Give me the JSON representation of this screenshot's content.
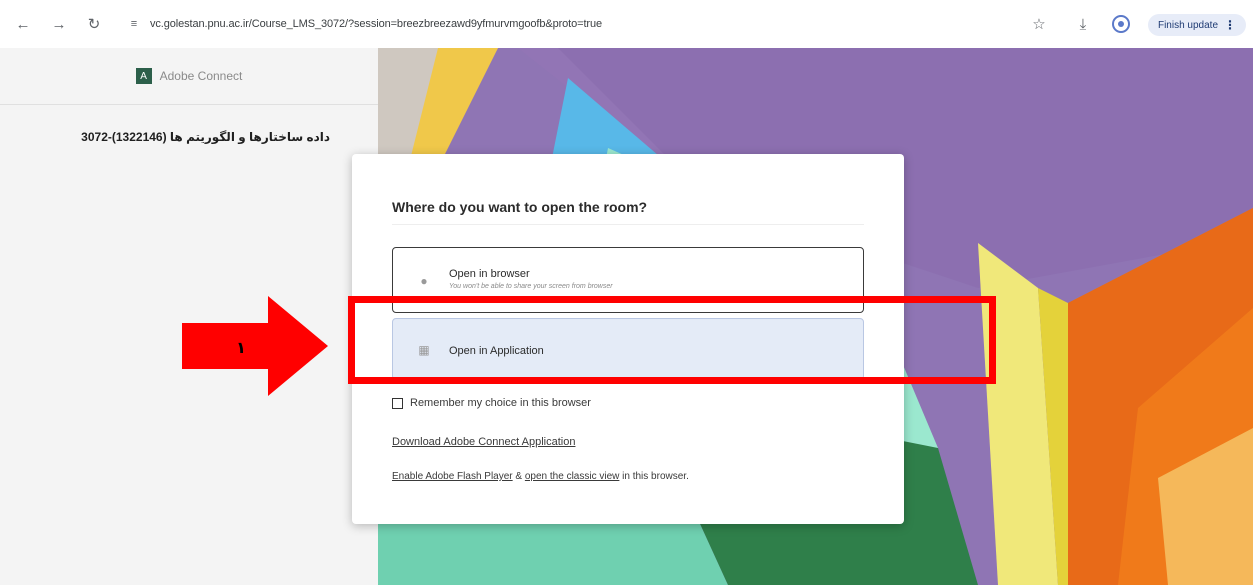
{
  "browser": {
    "url": "vc.golestan.pnu.ac.ir/Course_LMS_3072/?session=breezbreezawd9yfmurvmgoofb&proto=true",
    "finish_update_label": "Finish update",
    "icons": [
      "back-icon",
      "forward-icon",
      "reload-icon",
      "site-settings-icon",
      "bookmark-star-icon",
      "download-icon",
      "profile-icon",
      "menu-icon"
    ]
  },
  "sidebar": {
    "brand": "Adobe Connect",
    "course_title": "داده ساختارها و الگوریتم ها (1322146)-3072"
  },
  "dialog": {
    "title": "Where do you want to open the room?",
    "option_browser": {
      "label": "Open in browser",
      "sub": "You won't be able to share your screen from browser"
    },
    "option_app": {
      "label": "Open in Application"
    },
    "remember_label": "Remember my choice in this browser",
    "remember_checked": false,
    "download_link": "Download Adobe Connect Application",
    "enable_flash_link": "Enable Adobe Flash Player",
    "enable_amp": "&",
    "classic_view_link": "open the classic view",
    "enable_tail": "in this browser."
  },
  "annotation": {
    "step_label": "۱",
    "highlight_color": "#ff0000"
  },
  "colors": {
    "accent_purple": "#8f75b4",
    "highlight_red": "#ff0000",
    "selected_option_bg": "#e4ebf7"
  }
}
